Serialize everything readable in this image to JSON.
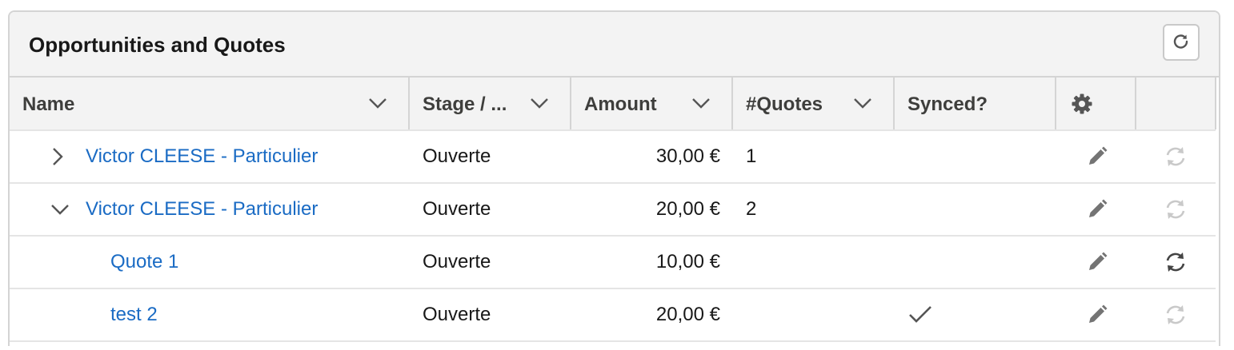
{
  "card": {
    "title": "Opportunities and Quotes",
    "refresh_icon": "refresh-icon"
  },
  "columns": [
    {
      "label": "Name",
      "has_menu": true
    },
    {
      "label": "Stage / ...",
      "has_menu": true
    },
    {
      "label": "Amount",
      "has_menu": true
    },
    {
      "label": "#Quotes",
      "has_menu": true
    },
    {
      "label": "Synced?",
      "has_menu": false
    },
    {
      "label": "",
      "icon": "gear-icon"
    },
    {
      "label": ""
    }
  ],
  "rows": [
    {
      "name": "Victor CLEESE - Particulier",
      "toggle": "chevron-right-icon",
      "stage": "Ouverte",
      "amount": "30,00 €",
      "quotes": "1",
      "synced": false,
      "sync_enabled": false
    },
    {
      "name": "Victor CLEESE - Particulier",
      "toggle": "chevron-down-icon",
      "stage": "Ouverte",
      "amount": "20,00 €",
      "quotes": "2",
      "synced": false,
      "sync_enabled": false
    },
    {
      "name": "Quote 1",
      "toggle": "",
      "stage": "Ouverte",
      "amount": "10,00 €",
      "quotes": "",
      "synced": false,
      "sync_enabled": true
    },
    {
      "name": "test 2",
      "toggle": "",
      "stage": "Ouverte",
      "amount": "20,00 €",
      "quotes": "",
      "synced": true,
      "sync_enabled": false
    }
  ],
  "colors": {
    "link": "#1a6bc4",
    "header_bg": "#f3f3f3",
    "border": "#d4d4d4",
    "icon": "#747474",
    "icon_disabled": "#c9c9c9"
  }
}
